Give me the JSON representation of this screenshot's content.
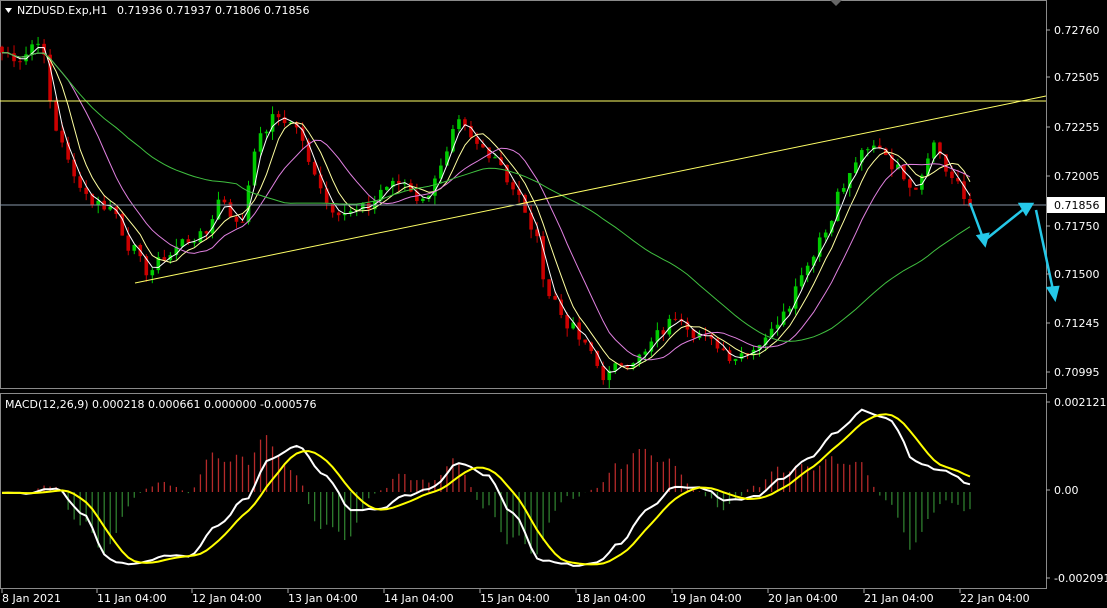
{
  "symbol": {
    "label": "NZDUSD.Exp,H1",
    "ohlc": "0.71936 0.71937 0.71806 0.71856"
  },
  "macd": {
    "label": "MACD(12,26,9) 0.000218 0.000661 0.000000 -0.000576"
  },
  "price_axis": {
    "ticks": [
      "0.72760",
      "0.72505",
      "0.72255",
      "0.72005",
      "0.71750",
      "0.71500",
      "0.71245",
      "0.70995"
    ],
    "current": "0.71856"
  },
  "macd_axis": {
    "ticks": [
      "0.002121",
      "0.00",
      "-0.002091"
    ]
  },
  "time_axis": {
    "labels": [
      "8 Jan 2021",
      "11 Jan 04:00",
      "12 Jan 04:00",
      "13 Jan 04:00",
      "14 Jan 04:00",
      "15 Jan 04:00",
      "18 Jan 04:00",
      "19 Jan 04:00",
      "20 Jan 04:00",
      "21 Jan 04:00",
      "22 Jan 04:00"
    ]
  },
  "colors": {
    "bull": "#00cc00",
    "bear": "#cc0000",
    "ma_fast": "#ffffff",
    "ma_mid": "#ffffa0",
    "ma_slow": "#e080e0",
    "ma_long": "#40c040",
    "trend": "#ffff66",
    "arrow": "#25c8e8",
    "macd_line": "#ffffff",
    "signal_line": "#ffff00"
  },
  "chart_data": {
    "type": "candlestick",
    "timeframe": "H1",
    "price_keypoints": [
      0.7265,
      0.7262,
      0.7272,
      0.7225,
      0.72,
      0.7188,
      0.7185,
      0.7165,
      0.7152,
      0.716,
      0.7168,
      0.717,
      0.719,
      0.7175,
      0.722,
      0.7232,
      0.7228,
      0.7205,
      0.7185,
      0.7182,
      0.7185,
      0.7196,
      0.7198,
      0.7188,
      0.7205,
      0.7228,
      0.7217,
      0.7212,
      0.7195,
      0.7175,
      0.714,
      0.7125,
      0.7113,
      0.7098,
      0.7105,
      0.7108,
      0.712,
      0.713,
      0.712,
      0.7115,
      0.7108,
      0.7112,
      0.712,
      0.7135,
      0.7155,
      0.7172,
      0.7195,
      0.7212,
      0.7217,
      0.7205,
      0.7196,
      0.7218,
      0.72,
      0.71856
    ],
    "macd_keypoints": [
      0.0,
      -5e-05,
      0.0001,
      -0.0005,
      -0.0016,
      -0.0017,
      -0.0015,
      -0.0015,
      -0.0008,
      -0.0002,
      0.0008,
      0.0011,
      0.0004,
      -0.0004,
      -0.0004,
      -0.0001,
      0.0001,
      0.0007,
      0.0004,
      -0.0005,
      -0.0016,
      -0.0017,
      -0.0017,
      -0.0012,
      -0.0004,
      0.0001,
      0.0001,
      -0.0002,
      -0.0001,
      0.0003,
      0.0008,
      0.0014,
      0.0019,
      0.0017,
      0.0007,
      0.0005,
      0.0002
    ],
    "ylim_price": [
      0.7094,
      0.729
    ],
    "ylim_macd": [
      -0.0022,
      0.0022
    ]
  }
}
